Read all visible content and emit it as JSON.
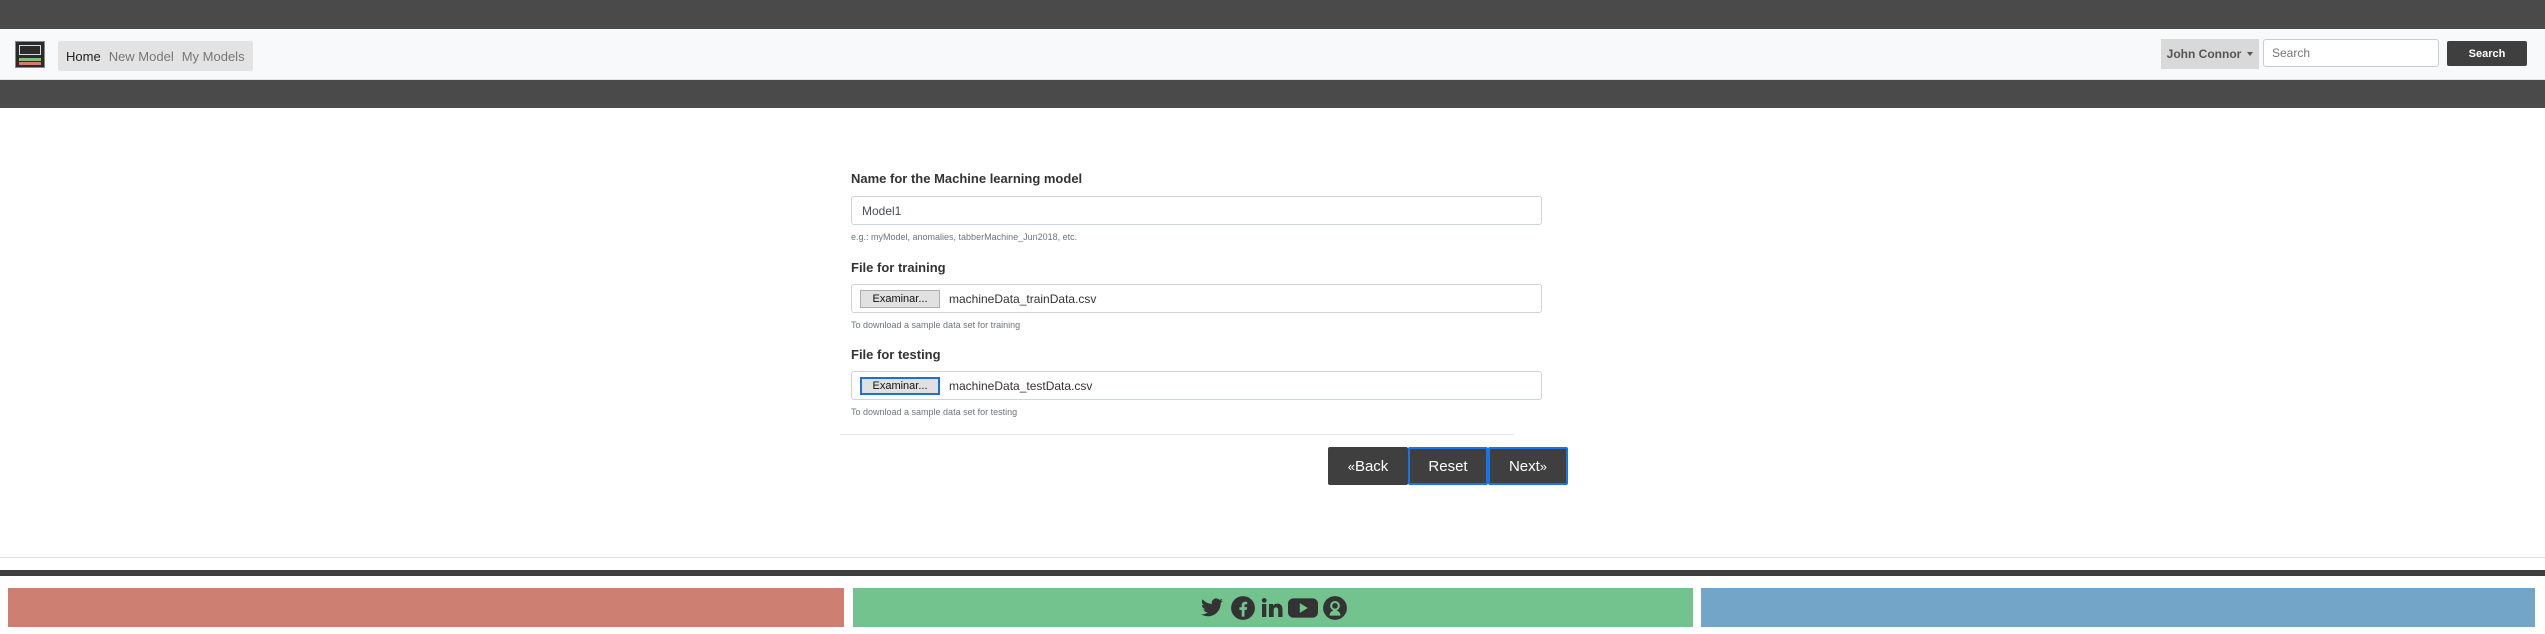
{
  "nav": {
    "links": [
      "Home",
      "New Model",
      "My Models"
    ],
    "user": "John Connor",
    "search_placeholder": "Search",
    "search_button": "Search"
  },
  "form": {
    "model_name_label": "Name for the Machine learning model",
    "model_name_value": "Model1",
    "model_name_help": "e.g.: myModel, anomalies, tabberMachine_Jun2018, etc.",
    "training_label": "File for training",
    "training_button": "Examinar...",
    "training_file": "machineData_trainData.csv",
    "training_help": "To download a sample data set for training",
    "testing_label": "File for testing",
    "testing_button": "Examinar...",
    "testing_file": "machineData_testData.csv",
    "testing_help": "To download a sample data set for testing"
  },
  "actions": {
    "back": "Back",
    "reset": "Reset",
    "next": "Next"
  },
  "footer": {
    "colors": {
      "left": "#cd7f72",
      "middle": "#72c38d",
      "right": "#73a5c9"
    },
    "icons": [
      "twitter-icon",
      "facebook-icon",
      "linkedin-icon",
      "youtube-icon",
      "github-icon"
    ]
  }
}
